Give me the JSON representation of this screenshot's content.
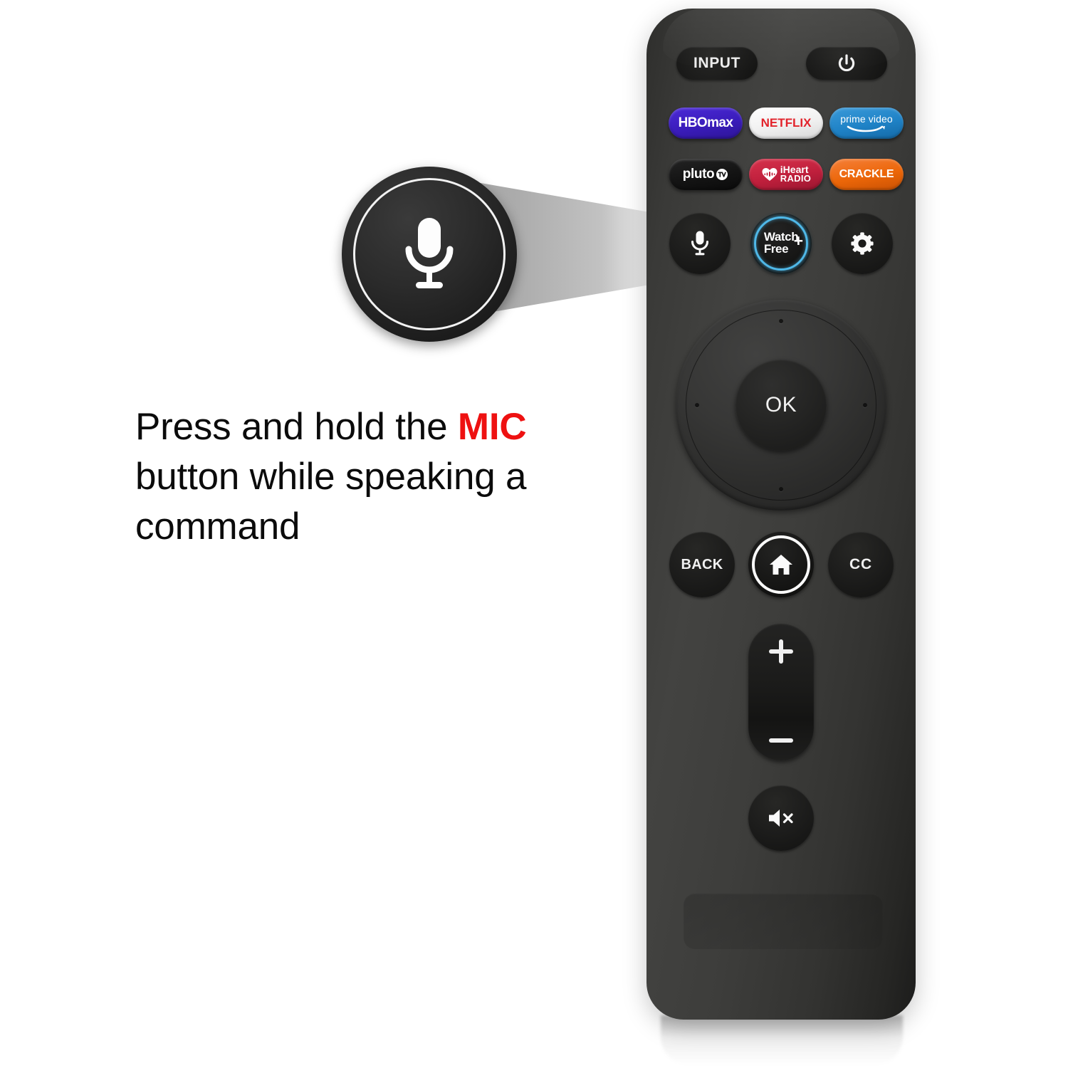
{
  "instruction": {
    "part1": "Press and hold the ",
    "highlight": "MIC",
    "part2": " button while speaking a command",
    "highlight_color": "#ee1111"
  },
  "callout": {
    "icon": "microphone-icon",
    "purpose": "magnified-view-of-mic-button"
  },
  "remote": {
    "body_color": "#3a3a38",
    "top_row": {
      "input_label": "INPUT",
      "power_icon": "power-icon"
    },
    "app_buttons": [
      {
        "id": "hbomax",
        "label": "HBOmax",
        "color": "#3a1cbb"
      },
      {
        "id": "netflix",
        "label": "NETFLIX",
        "color": "#ffffff",
        "text_color": "#e2232b"
      },
      {
        "id": "prime",
        "label": "prime video",
        "color": "#1f82c6"
      },
      {
        "id": "pluto",
        "label": "pluto",
        "color": "#141414"
      },
      {
        "id": "iheart",
        "label_top": "iHeart",
        "label_bottom": "RADIO",
        "color": "#bf1f3c"
      },
      {
        "id": "crackle",
        "label": "CRACKLE",
        "color": "#ec6608"
      }
    ],
    "function_row": {
      "mic_icon": "microphone-icon",
      "watchfree_line1": "Watch",
      "watchfree_line2": "Free",
      "watchfree_plus": "+",
      "watchfree_ring_color": "#4fb8e8",
      "settings_icon": "gear-icon"
    },
    "dpad": {
      "ok_label": "OK",
      "directions": [
        "up",
        "down",
        "left",
        "right"
      ]
    },
    "nav_row": {
      "back_label": "BACK",
      "home_icon": "home-icon",
      "cc_label": "CC"
    },
    "volume": {
      "up_icon": "plus-icon",
      "down_icon": "minus-icon"
    },
    "mute": {
      "icon": "speaker-mute-icon"
    }
  }
}
